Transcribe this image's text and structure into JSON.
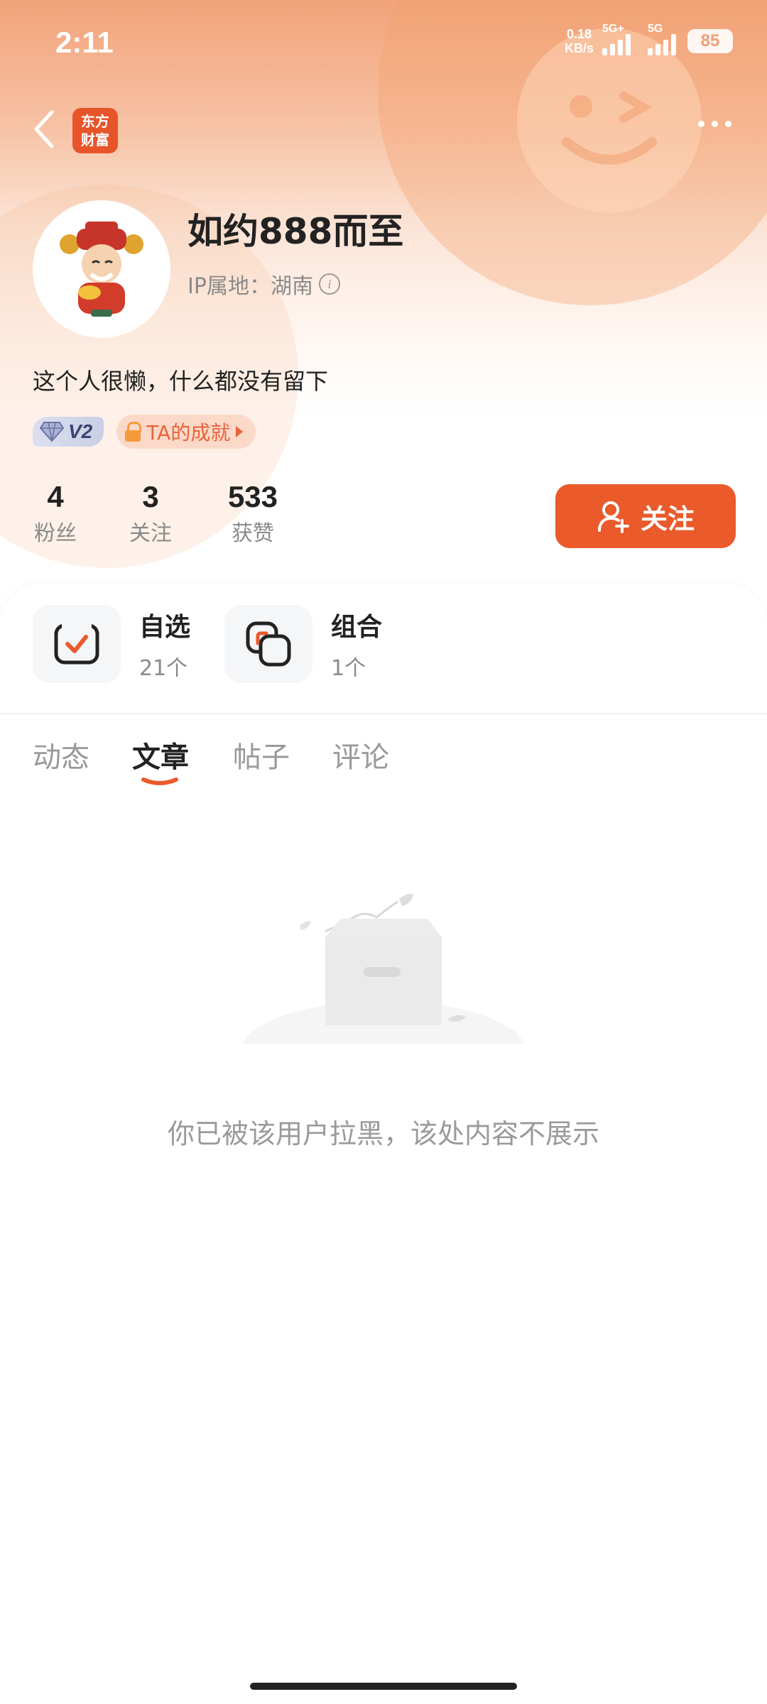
{
  "status_bar": {
    "time": "2:11",
    "net_speed_value": "0.18",
    "net_speed_unit": "KB/s",
    "sim1_tag": "5G+",
    "sim2_tag": "5G",
    "battery": "85"
  },
  "header": {
    "app_logo_line1": "东方",
    "app_logo_line2": "财富"
  },
  "profile": {
    "username": "如约888而至",
    "ip_label": "IP属地：湖南",
    "bio": "这个人很懒，什么都没有留下",
    "level": "V2",
    "achievement": "TA的成就"
  },
  "stats": [
    {
      "value": "4",
      "label": "粉丝"
    },
    {
      "value": "3",
      "label": "关注"
    },
    {
      "value": "533",
      "label": "获赞"
    }
  ],
  "follow_button": "关注",
  "quick_links": [
    {
      "title": "自选",
      "count": "21个",
      "icon": "checkbox-icon"
    },
    {
      "title": "组合",
      "count": "1个",
      "icon": "stack-icon"
    }
  ],
  "tabs": [
    {
      "label": "动态",
      "active": false
    },
    {
      "label": "文章",
      "active": true
    },
    {
      "label": "帖子",
      "active": false
    },
    {
      "label": "评论",
      "active": false
    }
  ],
  "empty_state": {
    "message": "你已被该用户拉黑，该处内容不展示"
  },
  "colors": {
    "accent": "#ea5a2a",
    "hero_top": "#f2a37a"
  }
}
